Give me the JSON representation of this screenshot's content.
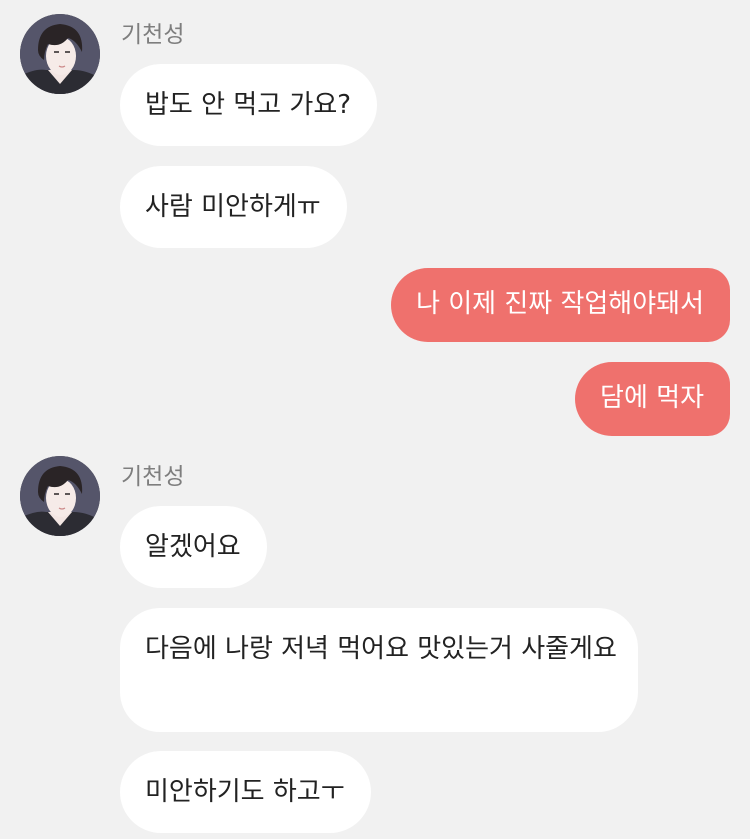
{
  "messages": [
    {
      "sender": "기천성",
      "avatar": "avatar-icon"
    },
    {
      "text": "밥도 안 먹고 가요?"
    },
    {
      "text": "사람 미안하게ㅠ"
    },
    {
      "text": "나 이제 진짜 작업해야돼서"
    },
    {
      "text": "담에 먹자"
    },
    {
      "sender": "기천성",
      "avatar": "avatar-icon"
    },
    {
      "text": "알겠어요"
    },
    {
      "text": "다음에 나랑 저녁 먹어요 맛있는거 사줄게요"
    },
    {
      "text": "미안하기도 하고ㅜ"
    }
  ],
  "colors": {
    "background": "#f1f1f1",
    "incoming_bubble": "#ffffff",
    "outgoing_bubble": "#ef716d",
    "sender_name": "#7e7e7e"
  }
}
